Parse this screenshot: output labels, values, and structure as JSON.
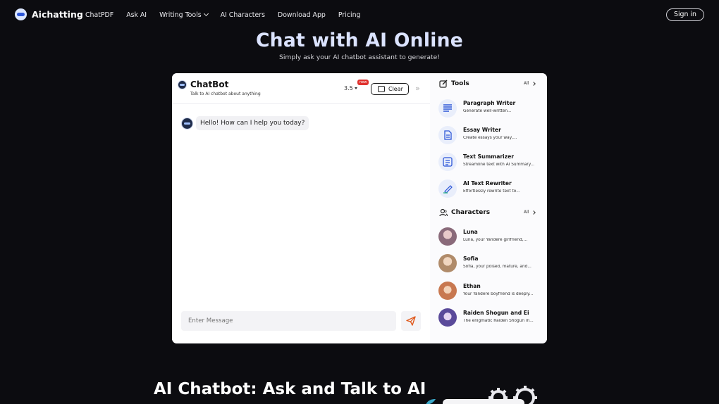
{
  "nav": {
    "brand": "Aichatting",
    "links": [
      {
        "label": "ChatPDF"
      },
      {
        "label": "Ask AI"
      },
      {
        "label": "Writing Tools"
      },
      {
        "label": "AI Characters"
      },
      {
        "label": "Download App"
      },
      {
        "label": "Pricing"
      }
    ],
    "signin": "Sign in"
  },
  "hero": {
    "title": "Chat with AI Online",
    "subtitle": "Simply ask your AI chatbot assistant to generate!"
  },
  "chat": {
    "title": "ChatBot",
    "subtitle": "Talk to AI chatbot about anything",
    "model": "3.5",
    "new_badge": "new",
    "clear_label": "Clear",
    "greeting": "Hello! How can I help you today?",
    "input_placeholder": "Enter Message"
  },
  "tools": {
    "title": "Tools",
    "all_label": "All",
    "items": [
      {
        "name": "Paragraph Writer",
        "desc": "Generate well-written...",
        "icon": "paragraph-icon"
      },
      {
        "name": "Essay Writer",
        "desc": "Create essays your way,...",
        "icon": "document-icon"
      },
      {
        "name": "Text Summarizer",
        "desc": "Streamline text with AI Summary...",
        "icon": "summary-list-icon"
      },
      {
        "name": "AI Text Rewriter",
        "desc": "Effortlessly rewrite text to...",
        "icon": "pen-rewrite-icon"
      }
    ]
  },
  "characters": {
    "title": "Characters",
    "all_label": "All",
    "items": [
      {
        "name": "Luna",
        "desc": "Luna, your Yandere girlfriend,...",
        "color": "#8a6a7a"
      },
      {
        "name": "Sofia",
        "desc": "Sofia, your poised, mature, and...",
        "color": "#b08b6a"
      },
      {
        "name": "Ethan",
        "desc": "Your Yandere boyfriend is deeply...",
        "color": "#c87850"
      },
      {
        "name": "Raiden Shogun and Ei",
        "desc": "The enigmatic Raiden Shogun in...",
        "color": "#5a4a9a"
      }
    ]
  },
  "bottom": {
    "title": "AI Chatbot: Ask and Talk to AI"
  },
  "colors": {
    "background": "#0c0c10",
    "hero_title": "#dbe3ff",
    "accent_blue": "#2c56d8",
    "new_badge": "#e0322e"
  }
}
